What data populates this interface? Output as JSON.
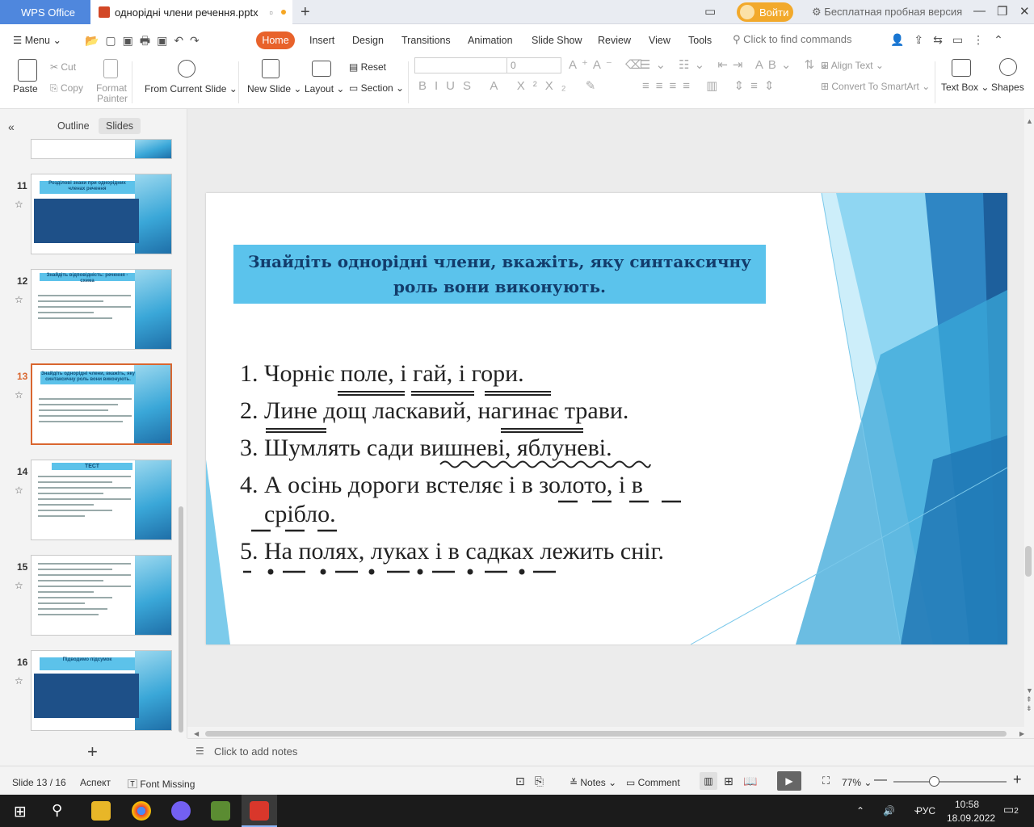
{
  "titlebar": {
    "wps_tab": "WPS Office",
    "doc_tab": "однорідні члени речення.pptx",
    "login": "Войти",
    "trial": "Бесплатная пробная версия"
  },
  "menu": {
    "menu": "Menu",
    "home": "Home",
    "insert": "Insert",
    "design": "Design",
    "transitions": "Transitions",
    "animation": "Animation",
    "slideshow": "Slide Show",
    "review": "Review",
    "view": "View",
    "tools": "Tools",
    "search": "Click to find commands"
  },
  "ribbon": {
    "paste": "Paste",
    "cut": "Cut",
    "copy": "Copy",
    "format_painter_1": "Format",
    "format_painter_2": "Painter",
    "from_current": "From Current Slide",
    "new_slide": "New Slide",
    "layout": "Layout",
    "reset": "Reset",
    "section": "Section",
    "font_size": "0",
    "align_text": "Align Text",
    "convert": "Convert To SmartArt",
    "textbox": "Text Box",
    "shapes": "Shapes"
  },
  "panel": {
    "outline": "Outline",
    "slides": "Slides",
    "thumbs": [
      {
        "num": "11",
        "title": "Розділові знаки при однорідних членах речення"
      },
      {
        "num": "12",
        "title": "Знайдіть відповідність: речення - схема"
      },
      {
        "num": "13",
        "title": "Знайдіть однорідні члени, вкажіть, яку синтаксичну роль вони виконують."
      },
      {
        "num": "14",
        "title": "ТЕСТ"
      },
      {
        "num": "15",
        "title": ""
      },
      {
        "num": "16",
        "title": "Підводимо підсумок"
      }
    ]
  },
  "slide": {
    "title_line1": "Знайдіть однорідні члени, вкажіть, яку синтаксичну",
    "title_line2": "роль вони виконують.",
    "lines": [
      "1. Чорніє поле, і гай, і гори.",
      "2. Лине дощ ласкавий, нагинає трави.",
      "3. Шумлять сади вишневі, яблуневі.",
      "4. А осінь дороги встеляє і в золото, і в",
      "    срібло.",
      "5. На полях, луках і в садках лежить сніг."
    ]
  },
  "notes": "Click to add notes",
  "status": {
    "slide": "Slide 13 / 16",
    "theme": "Аспект",
    "font_missing": "Font Missing",
    "notes": "Notes",
    "comment": "Comment",
    "zoom": "77%"
  },
  "tray": {
    "lang": "РУС",
    "time": "10:58",
    "date": "18.09.2022",
    "notif": "2"
  }
}
